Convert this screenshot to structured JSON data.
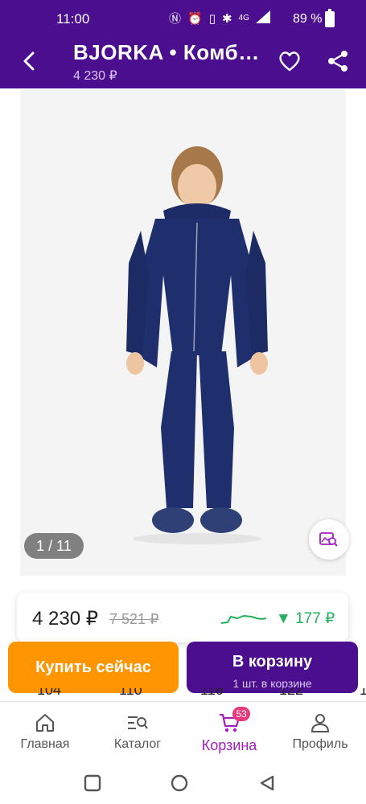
{
  "status_bar": {
    "time": "11:00",
    "network": "4G",
    "battery": "89 %"
  },
  "header": {
    "title": "BJORKA • Комб…",
    "price": "4 230 ₽",
    "icons": {
      "back": "arrow-back-icon",
      "favorite": "heart-icon",
      "share": "share-icon"
    }
  },
  "gallery": {
    "counter": "1 / 11",
    "visual_search_icon": "image-search-icon"
  },
  "price_card": {
    "current": "4 230 ₽",
    "old": "7 521 ₽",
    "diff": "▼ 177 ₽",
    "trend_color": "#21b05c"
  },
  "actions": {
    "buy_now": "Купить сейчас",
    "add_to_cart": "В корзину",
    "in_cart_count": "1 шт. в корзине"
  },
  "sizes_peek": [
    "104",
    "110",
    "116",
    "122",
    "1"
  ],
  "bottom_nav": {
    "items": [
      {
        "label": "Главная",
        "icon": "home-icon"
      },
      {
        "label": "Каталог",
        "icon": "catalog-search-icon"
      },
      {
        "label": "Корзина",
        "icon": "cart-icon",
        "badge": "53",
        "active": true
      },
      {
        "label": "Профиль",
        "icon": "profile-icon"
      }
    ]
  },
  "colors": {
    "brand_purple": "#4a0e8f",
    "buy_orange": "#ff9500",
    "active_nav": "#a020c0",
    "badge_pink": "#e8397c"
  }
}
